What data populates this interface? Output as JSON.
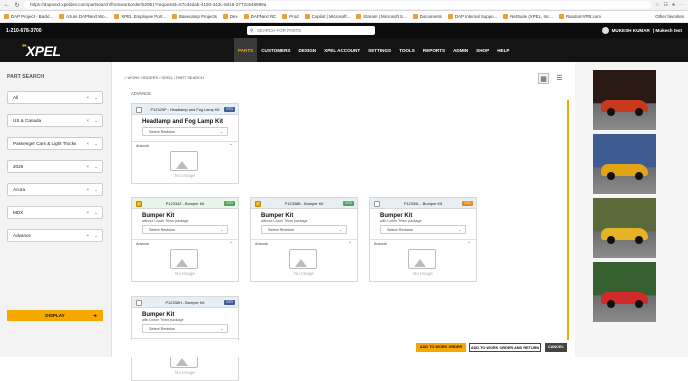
{
  "browser": {
    "url": "https://dapnext.xpeldev.com/partsearch/fromworkorder/52951?requestId=57cd4dab-4150-443c-8d15-2772c648998a",
    "bookmarks": [
      "DAP Project - Backl...",
      "Azure DAPNext Wo...",
      "XPEL Employee Port...",
      "Basecamp Projects",
      "Dev",
      "DAPNext RC",
      "Prod",
      "Copilot | Microsoft...",
      "Stream | Microsoft S...",
      "Documents",
      "DAP Internal Suppo...",
      "NetSuite (XPEL, Inc...",
      "RandomYPB.com"
    ],
    "other_favorites": "Other favorites"
  },
  "topbar": {
    "phone": "1-210-678-3700",
    "search_placeholder": "SEARCH FOR PARTS",
    "user": "MUKESH KUMAR",
    "user_suffix": "| Mukesh test"
  },
  "nav": {
    "logo": "XPEL",
    "items": [
      "PARTS",
      "CUSTOMERS",
      "DESIGN",
      "XPEL ACCOUNT",
      "SETTINGS",
      "TOOLS",
      "REPORTS",
      "ADMIN",
      "SHOP",
      "HELP"
    ]
  },
  "sidebar": {
    "title": "PART SEARCH",
    "filters": [
      "All",
      "US & Canada",
      "Passenger Cars & Light Trucks",
      "2025",
      "Acura",
      "MDX",
      "Advance"
    ],
    "display_label": "DISPLAY"
  },
  "main": {
    "breadcrumb": [
      "WORK ORDERS",
      "52951",
      "PART SEARCH"
    ],
    "section": "ADVANCE",
    "artwork_label": "Artwork",
    "no_image": "No Image",
    "cards": [
      {
        "code": "P12329P - Headlamp and Fog Lamp Kit",
        "badge": "STD",
        "name": "Headlamp and Fog Lamp Kit",
        "sub": "",
        "revision": "Select Revision",
        "checked": false,
        "style": "blue"
      },
      {
        "code": "P12334Z - Bumper Kit",
        "badge": "STD",
        "name": "Bumper Kit",
        "sub": "without Lower Trims package",
        "revision": "Select Revision",
        "checked": true,
        "style": "green"
      },
      {
        "code": "P12338B - Bumper Kit",
        "badge": "STD",
        "name": "Bumper Kit",
        "sub": "without Lower Trims package",
        "revision": "Select Revision",
        "checked": true,
        "style": "blue"
      },
      {
        "code": "P12339L - Bumper Kit",
        "badge": "STD",
        "name": "Bumper Kit",
        "sub": "with Lower Trims package",
        "revision": "Select Revision",
        "checked": false,
        "style": "blue"
      },
      {
        "code": "P12338H - Bumper Kit",
        "badge": "STD",
        "name": "Bumper Kit",
        "sub": "with Lower Trims package",
        "revision": "Select Revision",
        "checked": false,
        "style": "blue"
      }
    ]
  },
  "footer": {
    "add": "ADD TO WORK ORDER",
    "add_return": "ADD TO WORK ORDER AND RETURN",
    "cancel": "CANCEL"
  },
  "gallery": {
    "cars": [
      {
        "color": "#c8381e",
        "sky": "#2a1a14"
      },
      {
        "color": "#e2a414",
        "sky": "#3d5c92"
      },
      {
        "color": "#e6b325",
        "sky": "#5a6a3a"
      },
      {
        "color": "#d12a2a",
        "sky": "#355f2c"
      }
    ]
  }
}
